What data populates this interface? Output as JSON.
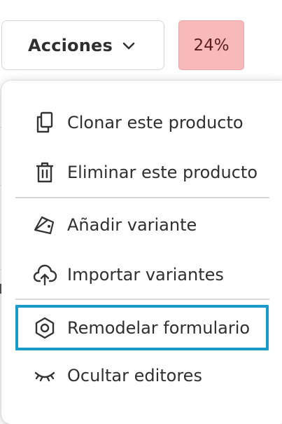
{
  "toolbar": {
    "actions_label": "Acciones",
    "percent": "24%"
  },
  "menu": {
    "items": [
      {
        "label": "Clonar este producto",
        "icon": "clone-icon"
      },
      {
        "label": "Eliminar este producto",
        "icon": "trash-icon"
      },
      {
        "label": "Añadir variante",
        "icon": "tag-icon"
      },
      {
        "label": "Importar variantes",
        "icon": "cloud-upload-icon"
      },
      {
        "label": "Remodelar formulario",
        "icon": "hexagon-settings-icon",
        "selected": true
      },
      {
        "label": "Ocultar editores",
        "icon": "eye-closed-icon"
      }
    ]
  },
  "colors": {
    "badge_bg": "#f7b9b9",
    "badge_text": "#5a1f1f",
    "selection_border": "#1a9ac9"
  }
}
